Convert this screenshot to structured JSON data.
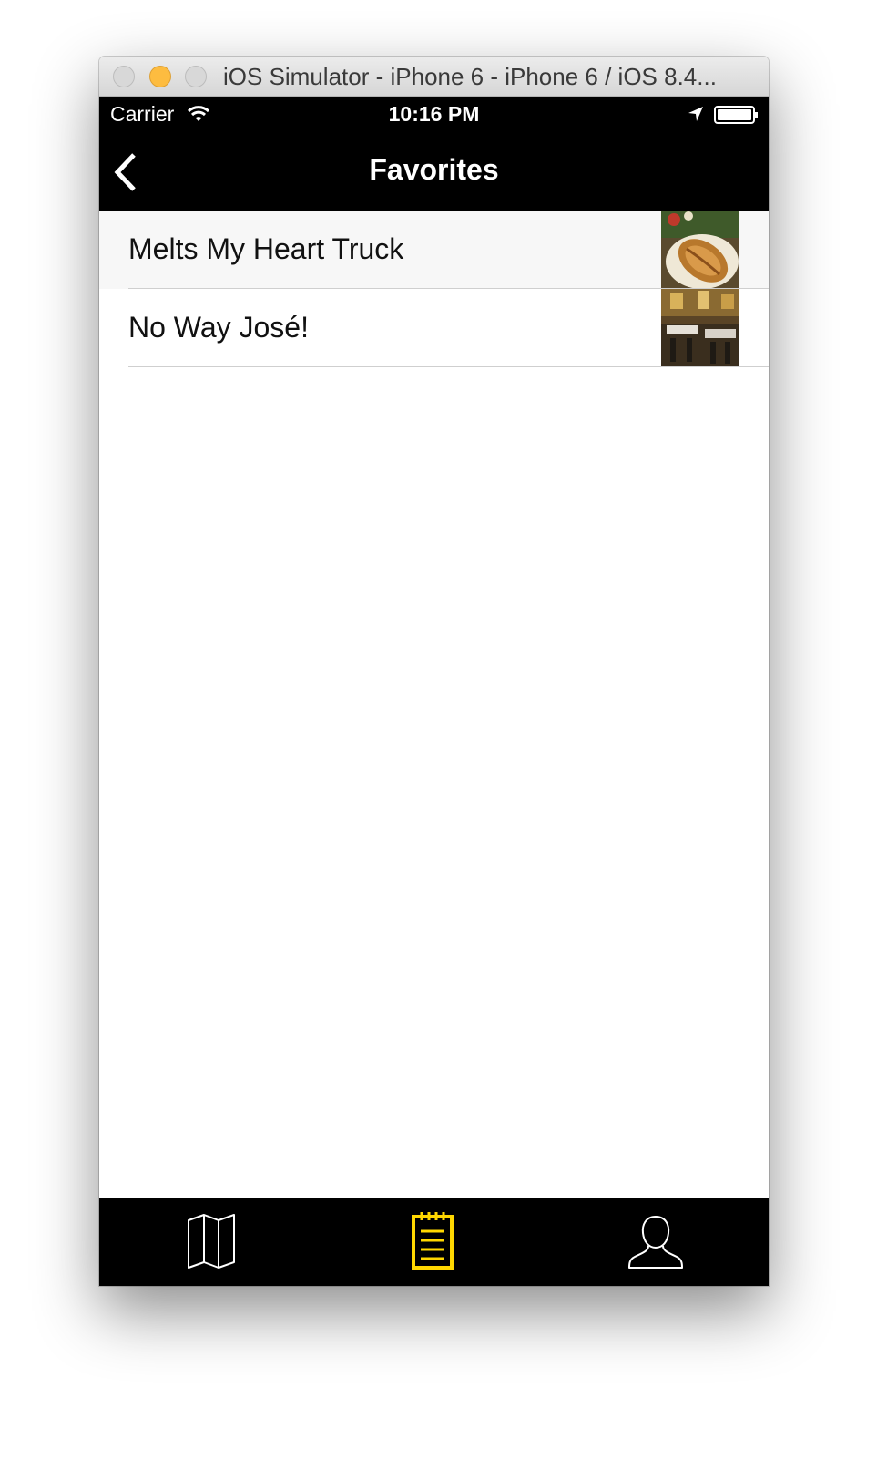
{
  "window": {
    "title": "iOS Simulator - iPhone 6 - iPhone 6 / iOS 8.4..."
  },
  "status_bar": {
    "carrier": "Carrier",
    "time": "10:16 PM",
    "icons": [
      "wifi-icon",
      "location-arrow-icon",
      "battery-icon"
    ]
  },
  "nav": {
    "title": "Favorites",
    "back_icon": "chevron-left-icon"
  },
  "favorites": [
    {
      "name": "Melts My Heart Truck",
      "thumbnail": "sandwich-photo"
    },
    {
      "name": "No Way José!",
      "thumbnail": "restaurant-interior-photo"
    }
  ],
  "tab_bar": {
    "tabs": [
      {
        "icon": "map-icon",
        "selected": false
      },
      {
        "icon": "notepad-list-icon",
        "selected": true
      },
      {
        "icon": "person-icon",
        "selected": false
      }
    ]
  },
  "colors": {
    "bar_background": "#000000",
    "selected_tab": "#FFD700",
    "unselected_tab": "#FFFFFF"
  }
}
